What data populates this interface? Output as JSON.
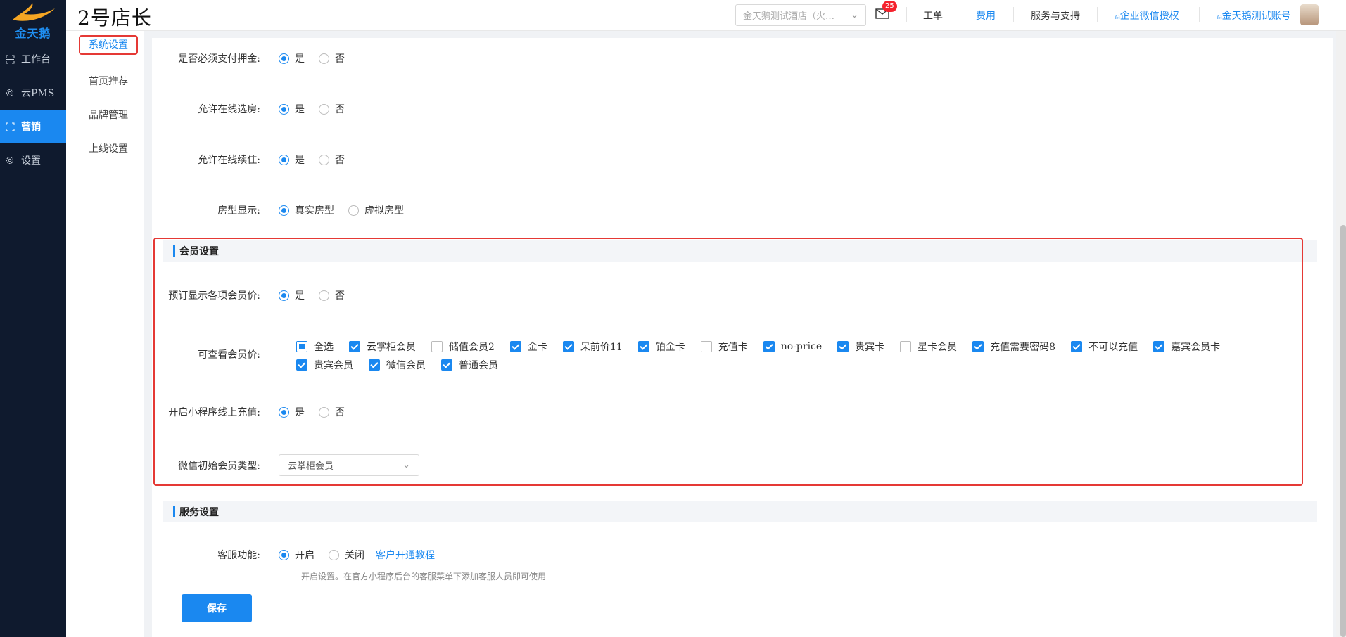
{
  "logo": {
    "text": "金天鹅"
  },
  "brand": "2号店长",
  "nav": [
    {
      "label": "工作台",
      "icon": "workbench-icon"
    },
    {
      "label": "云PMS",
      "icon": "gear-icon"
    },
    {
      "label": "营销",
      "icon": "marketing-icon",
      "active": true
    },
    {
      "label": "设置",
      "icon": "settings-icon"
    }
  ],
  "topbar": {
    "hotel": "金天鹅测试酒店（火…",
    "mail_count": "25",
    "links": {
      "workorder": "工单",
      "fee": "费用",
      "support": "服务与支持",
      "wechat_auth": "企业微信授权",
      "account": "金天鹅测试账号"
    }
  },
  "subnav": [
    "系统设置",
    "首页推荐",
    "品牌管理",
    "上线设置"
  ],
  "form": {
    "deposit": {
      "label": "是否必须支付押金:",
      "yes": "是",
      "no": "否"
    },
    "online_room": {
      "label": "允许在线选房:",
      "yes": "是",
      "no": "否"
    },
    "online_renew": {
      "label": "允许在线续住:",
      "yes": "是",
      "no": "否"
    },
    "room_display": {
      "label": "房型显示:",
      "real": "真实房型",
      "virtual": "虚拟房型"
    }
  },
  "member": {
    "title": "会员设置",
    "show_price": {
      "label": "预订显示各项会员价:",
      "yes": "是",
      "no": "否"
    },
    "visible_price": {
      "label": "可查看会员价:",
      "items": [
        {
          "label": "全选",
          "state": "ind"
        },
        {
          "label": "云掌柜会员",
          "state": "on"
        },
        {
          "label": "储值会员2",
          "state": "off"
        },
        {
          "label": "金卡",
          "state": "on"
        },
        {
          "label": "呆前价11",
          "state": "on"
        },
        {
          "label": "铂金卡",
          "state": "on"
        },
        {
          "label": "充值卡",
          "state": "off"
        },
        {
          "label": "no-price",
          "state": "on"
        },
        {
          "label": "贵宾卡",
          "state": "on"
        },
        {
          "label": "星卡会员",
          "state": "off"
        },
        {
          "label": "充值需要密码8",
          "state": "on"
        },
        {
          "label": "不可以充值",
          "state": "on"
        },
        {
          "label": "嘉宾会员卡",
          "state": "on"
        },
        {
          "label": "贵宾会员",
          "state": "on"
        },
        {
          "label": "微信会员",
          "state": "on"
        },
        {
          "label": "普通会员",
          "state": "on"
        }
      ]
    },
    "mini_recharge": {
      "label": "开启小程序线上充值:",
      "yes": "是",
      "no": "否"
    },
    "wechat_type": {
      "label": "微信初始会员类型:",
      "value": "云掌柜会员"
    }
  },
  "service": {
    "title": "服务设置",
    "kefu": {
      "label": "客服功能:",
      "on": "开启",
      "off": "关闭",
      "link": "客户开通教程"
    },
    "hint": "开启设置。在官方小程序后台的客服菜单下添加客服人员即可使用"
  },
  "save": "保存"
}
